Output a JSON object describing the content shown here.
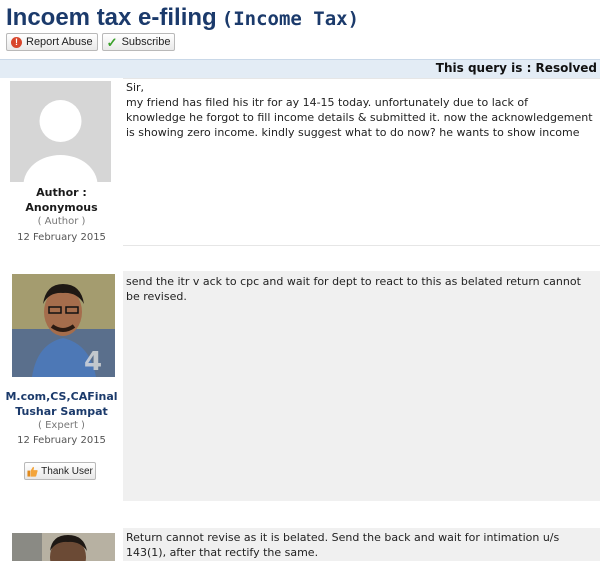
{
  "thread": {
    "title": "Incoem tax e-filing",
    "category": "(Income Tax)",
    "report_label": "Report Abuse",
    "subscribe_label": "Subscribe",
    "status": "This query is : Resolved"
  },
  "posts": [
    {
      "author_line1": "Author :",
      "author_line2": "Anonymous",
      "role": "( Author )",
      "date": "12 February 2015",
      "lines": [
        "Sir,",
        "my friend has filed his itr for ay 14-15 today. unfortunately due to lack of",
        "knowledge he forgot to fill income details & submitted it. now the acknowledgement",
        "is showing zero income. kindly suggest what to do now? he wants to show income"
      ]
    },
    {
      "author_line1": "M.com,CS,CAFinal",
      "author_line2": "Tushar Sampat",
      "role": "( Expert )",
      "date": "12 February 2015",
      "thank_label": "Thank User",
      "lines": [
        "send the itr v ack to cpc and wait for dept to react to this as belated return cannot",
        "be revised."
      ]
    },
    {
      "lines": [
        "Return cannot revise as it is belated. Send the back and wait for intimation u/s",
        "143(1), after that rectify the same."
      ]
    }
  ],
  "colors": {
    "title": "#1b3a6b",
    "status_bar": "#e3ecf5",
    "post_body": "#f0f0f0"
  }
}
